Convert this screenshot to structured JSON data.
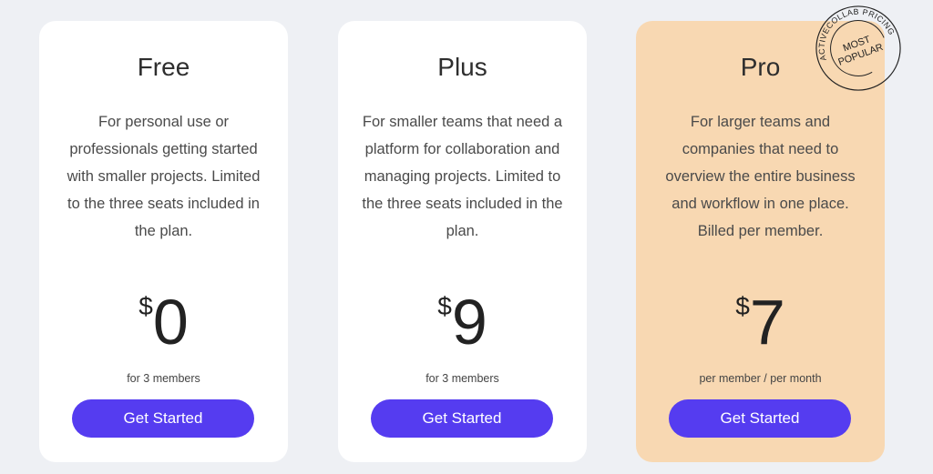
{
  "plans": [
    {
      "name": "Free",
      "description": "For personal use or professionals getting started with smaller projects. Limited to the three seats included in the plan.",
      "currency": "$",
      "price": "0",
      "note": "for 3 members",
      "cta": "Get Started"
    },
    {
      "name": "Plus",
      "description": "For smaller teams that need a platform for collaboration and managing projects. Limited to the three seats included in the plan.",
      "currency": "$",
      "price": "9",
      "note": "for 3 members",
      "cta": "Get Started"
    },
    {
      "name": "Pro",
      "description": "For larger teams and companies that need to overview the entire business and workflow in one place. Billed per member.",
      "currency": "$",
      "price": "7",
      "note": "per member / per month",
      "cta": "Get Started"
    }
  ],
  "badge": {
    "ring_text": "ACTIVECOLLAB PRICING",
    "line1": "MOST",
    "line2": "POPULAR"
  },
  "colors": {
    "accent": "#553cf0",
    "pro_card": "#f8d8b2",
    "background": "#eef0f4"
  }
}
